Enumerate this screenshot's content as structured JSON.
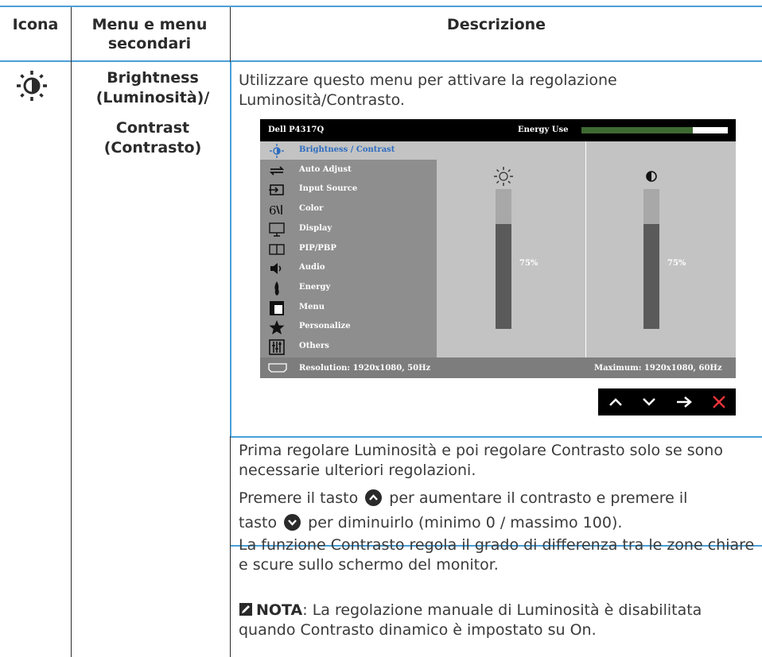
{
  "table": {
    "headers": {
      "icon": "Icona",
      "menu": "Menu e menu secondari",
      "desc": "Descrizione"
    }
  },
  "row": {
    "icon_name": "brightness-icon",
    "menu_label_1": "Brightness",
    "menu_label_2": "(Luminosità)/",
    "menu_label_3": "Contrast",
    "menu_label_4": "(Contrasto)",
    "intro": "Utilizzare questo menu per attivare la regolazione Luminosità/Contrasto."
  },
  "osd": {
    "model": "Dell P4317Q",
    "energy_label": "Energy Use",
    "energy_level": 0.76,
    "menu_items": [
      {
        "label": "Brightness / Contrast",
        "icon": "brightness-icon",
        "active": true
      },
      {
        "label": "Auto Adjust",
        "icon": "auto-adjust-icon",
        "active": false
      },
      {
        "label": "Input Source",
        "icon": "input-source-icon",
        "active": false
      },
      {
        "label": "Color",
        "icon": "color-icon",
        "active": false
      },
      {
        "label": "Display",
        "icon": "display-icon",
        "active": false
      },
      {
        "label": "PIP/PBP",
        "icon": "pip-pbp-icon",
        "active": false
      },
      {
        "label": "Audio",
        "icon": "audio-icon",
        "active": false
      },
      {
        "label": "Energy",
        "icon": "energy-icon",
        "active": false
      },
      {
        "label": "Menu",
        "icon": "menu-icon",
        "active": false
      },
      {
        "label": "Personalize",
        "icon": "star-icon",
        "active": false
      },
      {
        "label": "Others",
        "icon": "others-icon",
        "active": false
      }
    ],
    "brightness_value": "75%",
    "contrast_value": "75%",
    "brightness_level": 0.75,
    "contrast_level": 0.75,
    "resolution": "Resolution: 1920x1080, 50Hz",
    "maximum": "Maximum: 1920x1080, 60Hz",
    "nav_buttons": [
      "up-arrow-icon",
      "down-arrow-icon",
      "right-arrow-icon",
      "close-icon"
    ]
  },
  "desc": {
    "p1": "Prima regolare Luminosità e poi regolare Contrasto solo se sono necessarie ulteriori regolazioni.",
    "p2a": "Premere il tasto",
    "p2b": "per aumentare il contrasto e premere il",
    "p2c": "tasto",
    "p2d": "per diminuirlo (minimo 0 / massimo 100).",
    "p3": "La funzione Contrasto regola il grado di differenza tra le zone chiare e scure sullo schermo del monitor.",
    "note_label": "NOTA",
    "note_text": ": La regolazione manuale di Luminosità è disabilitata quando Contrasto dinamico è impostato su On."
  },
  "colors": {
    "rule": "#4a9fd8",
    "accent": "#2d6cc0",
    "close": "#e8343a",
    "energy": "#3e6a32"
  }
}
